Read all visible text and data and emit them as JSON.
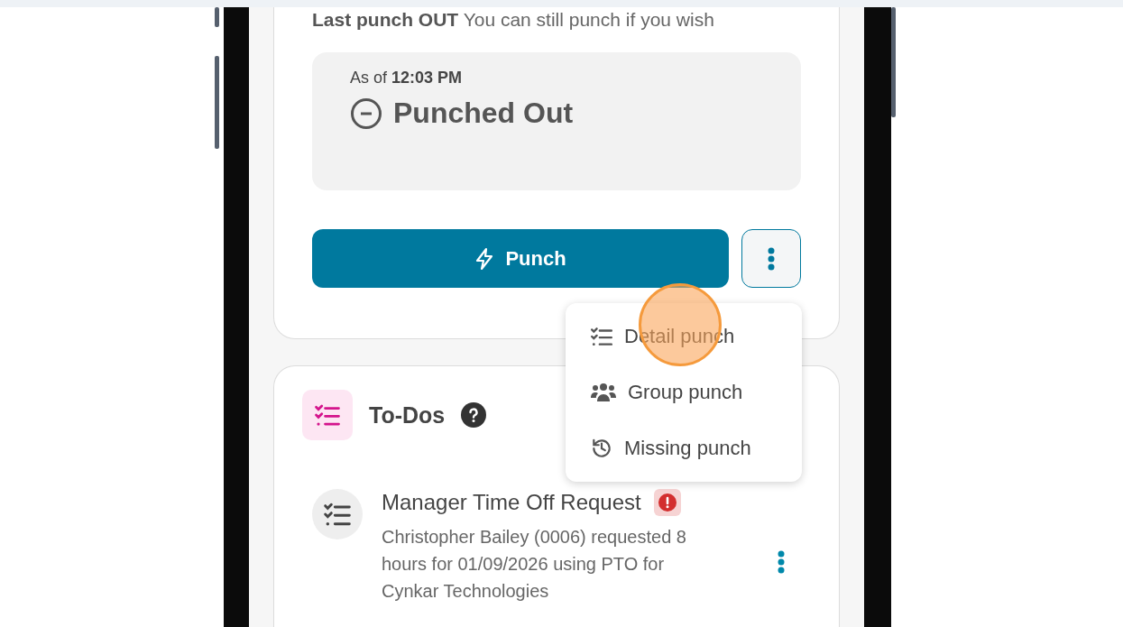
{
  "punch_card": {
    "last_punch": "**Last punch OUT** You can still punch if you wish",
    "as_of": "As of **12:03 PM**",
    "status": "Punched Out",
    "punch_button": "Punch"
  },
  "punch_menu": {
    "open": true,
    "items": [
      {
        "kind": "detail",
        "label": "Detail punch"
      },
      {
        "kind": "group",
        "label": "Group punch"
      },
      {
        "kind": "missing",
        "label": "Missing punch"
      }
    ]
  },
  "click_marker": {
    "shown": true
  },
  "todos": {
    "title": "To-Dos",
    "items": [
      {
        "title": "Manager Time Off Request",
        "urgent": true,
        "description": "Christopher Bailey (0006) requested 8 hours for 01/09/2026 using PTO for Cynkar Technologies"
      }
    ]
  }
}
